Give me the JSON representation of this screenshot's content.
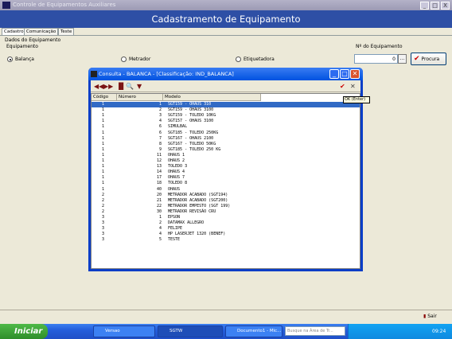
{
  "window": {
    "title": "Controle de Equipamentos Auxiliares",
    "min": "_",
    "max": "□",
    "close": "X"
  },
  "header": {
    "title": "Cadastramento de Equipamento"
  },
  "tabs": [
    "Cadastro",
    "Comunicação",
    "Teste"
  ],
  "form": {
    "section": "Dados do Equipamento",
    "group_label": "Equipamento",
    "radios": [
      "Balança",
      "Metrador",
      "Etiquetadora"
    ],
    "selected": "Balança",
    "num_label": "Nº do Equipamento",
    "num_value": "0",
    "dots": "...",
    "procura": "Procura"
  },
  "dialog": {
    "title": "Consulta - BALANCA - [Classificação: IND_BALANCA]",
    "columns": [
      "Código",
      "Número",
      "Modelo"
    ],
    "rows": [
      [
        "1",
        "1",
        "SGT159 - OHAUS 310"
      ],
      [
        "1",
        "2",
        "SGT159 - OHAUS 3100"
      ],
      [
        "1",
        "3",
        "SGT159 - TOLEDO 10KG"
      ],
      [
        "1",
        "4",
        "SGT157 - OHAUS 3100"
      ],
      [
        "1",
        "6",
        "SIMULBAL"
      ],
      [
        "1",
        "6",
        "SGT185 - TOLEDO 250KG"
      ],
      [
        "1",
        "7",
        "SGT167 - OHAUS 2100"
      ],
      [
        "1",
        "8",
        "SGT167 - TOLEDO 50KG"
      ],
      [
        "1",
        "9",
        "SGT185 - TOLEDO 250 KG"
      ],
      [
        "1",
        "11",
        "OHAUS 1"
      ],
      [
        "1",
        "12",
        "OHAUS 2"
      ],
      [
        "1",
        "13",
        "TOLEDO 3"
      ],
      [
        "1",
        "14",
        "OHAUS 4"
      ],
      [
        "1",
        "17",
        "OHAUS 7"
      ],
      [
        "1",
        "18",
        "TOLEDO 8"
      ],
      [
        "1",
        "40",
        "OHAUS"
      ],
      [
        "2",
        "20",
        "METRADOR ACABADO (SGT194)"
      ],
      [
        "2",
        "21",
        "METRADOR ACABADO (SGT200)"
      ],
      [
        "2",
        "22",
        "METRADOR EMPESTO (SGT 199)"
      ],
      [
        "2",
        "30",
        "METRADOR REVISÃO CRU"
      ],
      [
        "3",
        "1",
        "EPSON"
      ],
      [
        "3",
        "2",
        "DATAMAX ALLEGRO"
      ],
      [
        "3",
        "4",
        "FELIPE"
      ],
      [
        "3",
        "4",
        "HP LASERJET 1320 (BENEF)"
      ],
      [
        "3",
        "5",
        "TESTE"
      ]
    ],
    "selected_row": 0,
    "tooltip": "OK (Enter)"
  },
  "footer": {
    "sair": "Sair"
  },
  "taskbar": {
    "start": "Iniciar",
    "items": [
      "Versao",
      "SGTW",
      "Documento1 - Mic...",
      "SGTW"
    ],
    "search_placeholder": "Busque na Área de Tr...",
    "clock": "09:24"
  }
}
